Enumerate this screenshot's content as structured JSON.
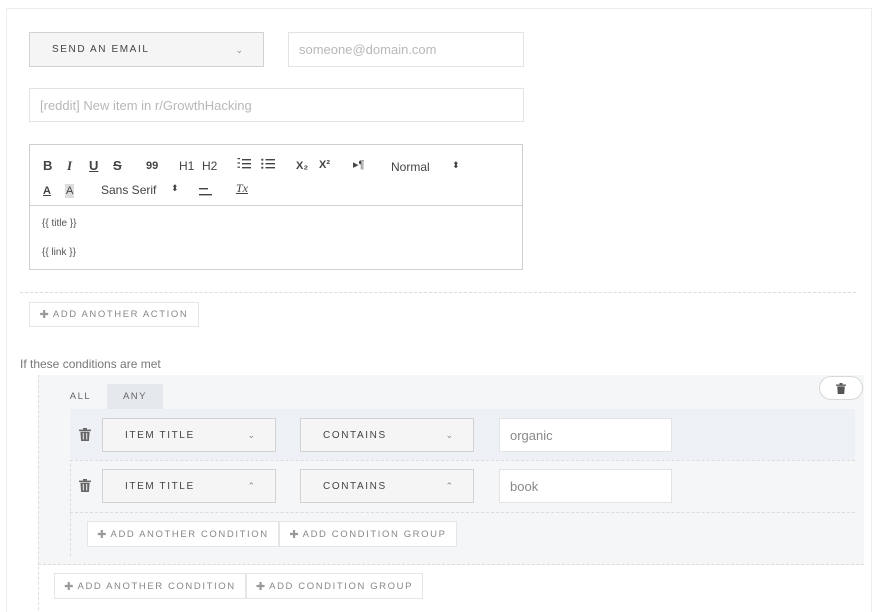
{
  "action": {
    "type_select": "SEND AN EMAIL",
    "email_placeholder": "someone@domain.com",
    "subject_placeholder": "[reddit] New item in r/GrowthHacking"
  },
  "editor": {
    "toolbar": {
      "bold": "B",
      "italic": "I",
      "underline": "U",
      "strike": "S",
      "quote": "99",
      "h1": "H1",
      "h2": "H2",
      "subscript": "X₂",
      "superscript": "X²",
      "direction": "▸¶",
      "size": "Normal",
      "font": "Sans Serif",
      "clean": "Tx"
    },
    "lines": [
      "{{ title }}",
      "{{ link }}"
    ]
  },
  "buttons": {
    "add_action": "ADD ANOTHER ACTION",
    "add_condition": "ADD ANOTHER CONDITION",
    "add_group": "ADD CONDITION GROUP"
  },
  "conditions": {
    "heading": "If these conditions are met",
    "tabs": [
      "ALL",
      "ANY"
    ],
    "active_tab": "ANY",
    "rows": [
      {
        "field": "ITEM TITLE",
        "operator": "CONTAINS",
        "value": "organic",
        "chevron": "⌄"
      },
      {
        "field": "ITEM TITLE",
        "operator": "CONTAINS",
        "value": "book",
        "chevron": "⌃"
      }
    ]
  },
  "colors": {
    "group_bg": "#f4f6f8",
    "row_bg": "#edf0f4",
    "border": "#d2d2d2"
  }
}
